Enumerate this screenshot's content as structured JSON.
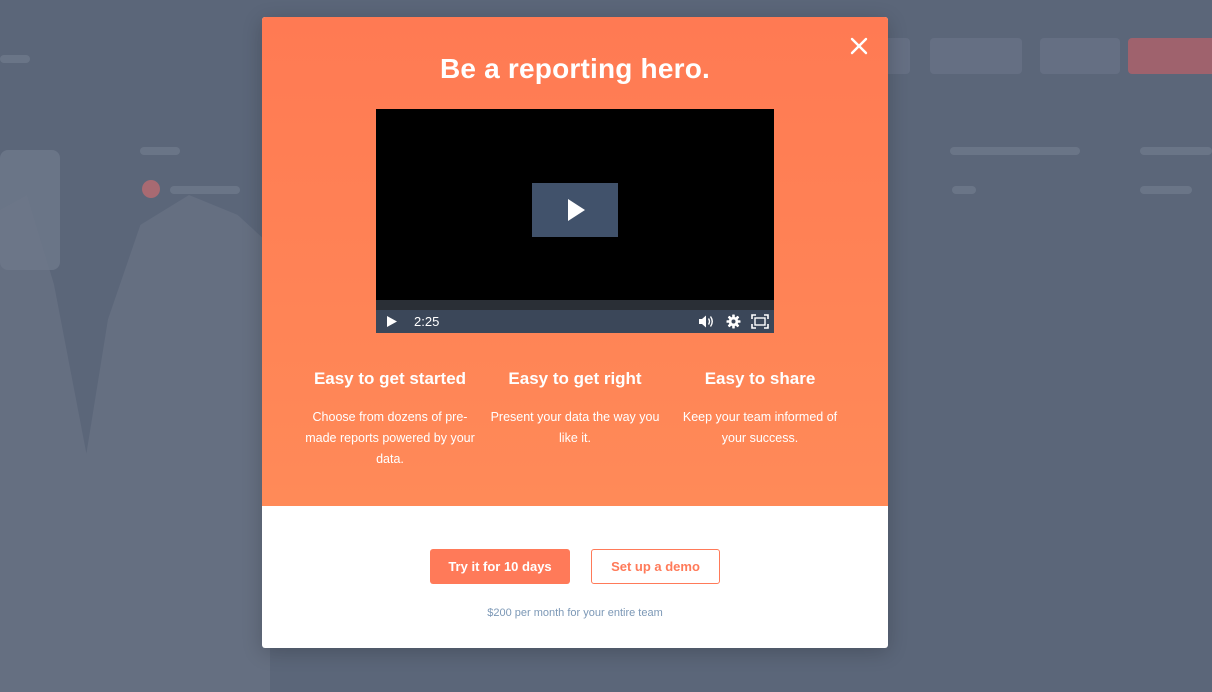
{
  "modal": {
    "headline": "Be a reporting hero.",
    "video": {
      "duration": "2:25"
    },
    "features": [
      {
        "title": "Easy to get started",
        "description": "Choose from dozens of pre-made reports powered by your data."
      },
      {
        "title": "Easy to get right",
        "description": "Present your data the way you like it."
      },
      {
        "title": "Easy to share",
        "description": "Keep your team informed of your success."
      }
    ],
    "primary_button": "Try it for 10 days",
    "secondary_button": "Set up a demo",
    "price_note": "$200 per month for your entire team"
  },
  "colors": {
    "accent": "#ff7a59",
    "overlay": "#5b6679",
    "video_controls": "#3b4759",
    "price_note": "#7c98b6"
  },
  "icons": {
    "close": "close-icon",
    "play": "play-icon",
    "volume": "volume-icon",
    "settings": "gear-icon",
    "fullscreen": "fullscreen-icon"
  }
}
